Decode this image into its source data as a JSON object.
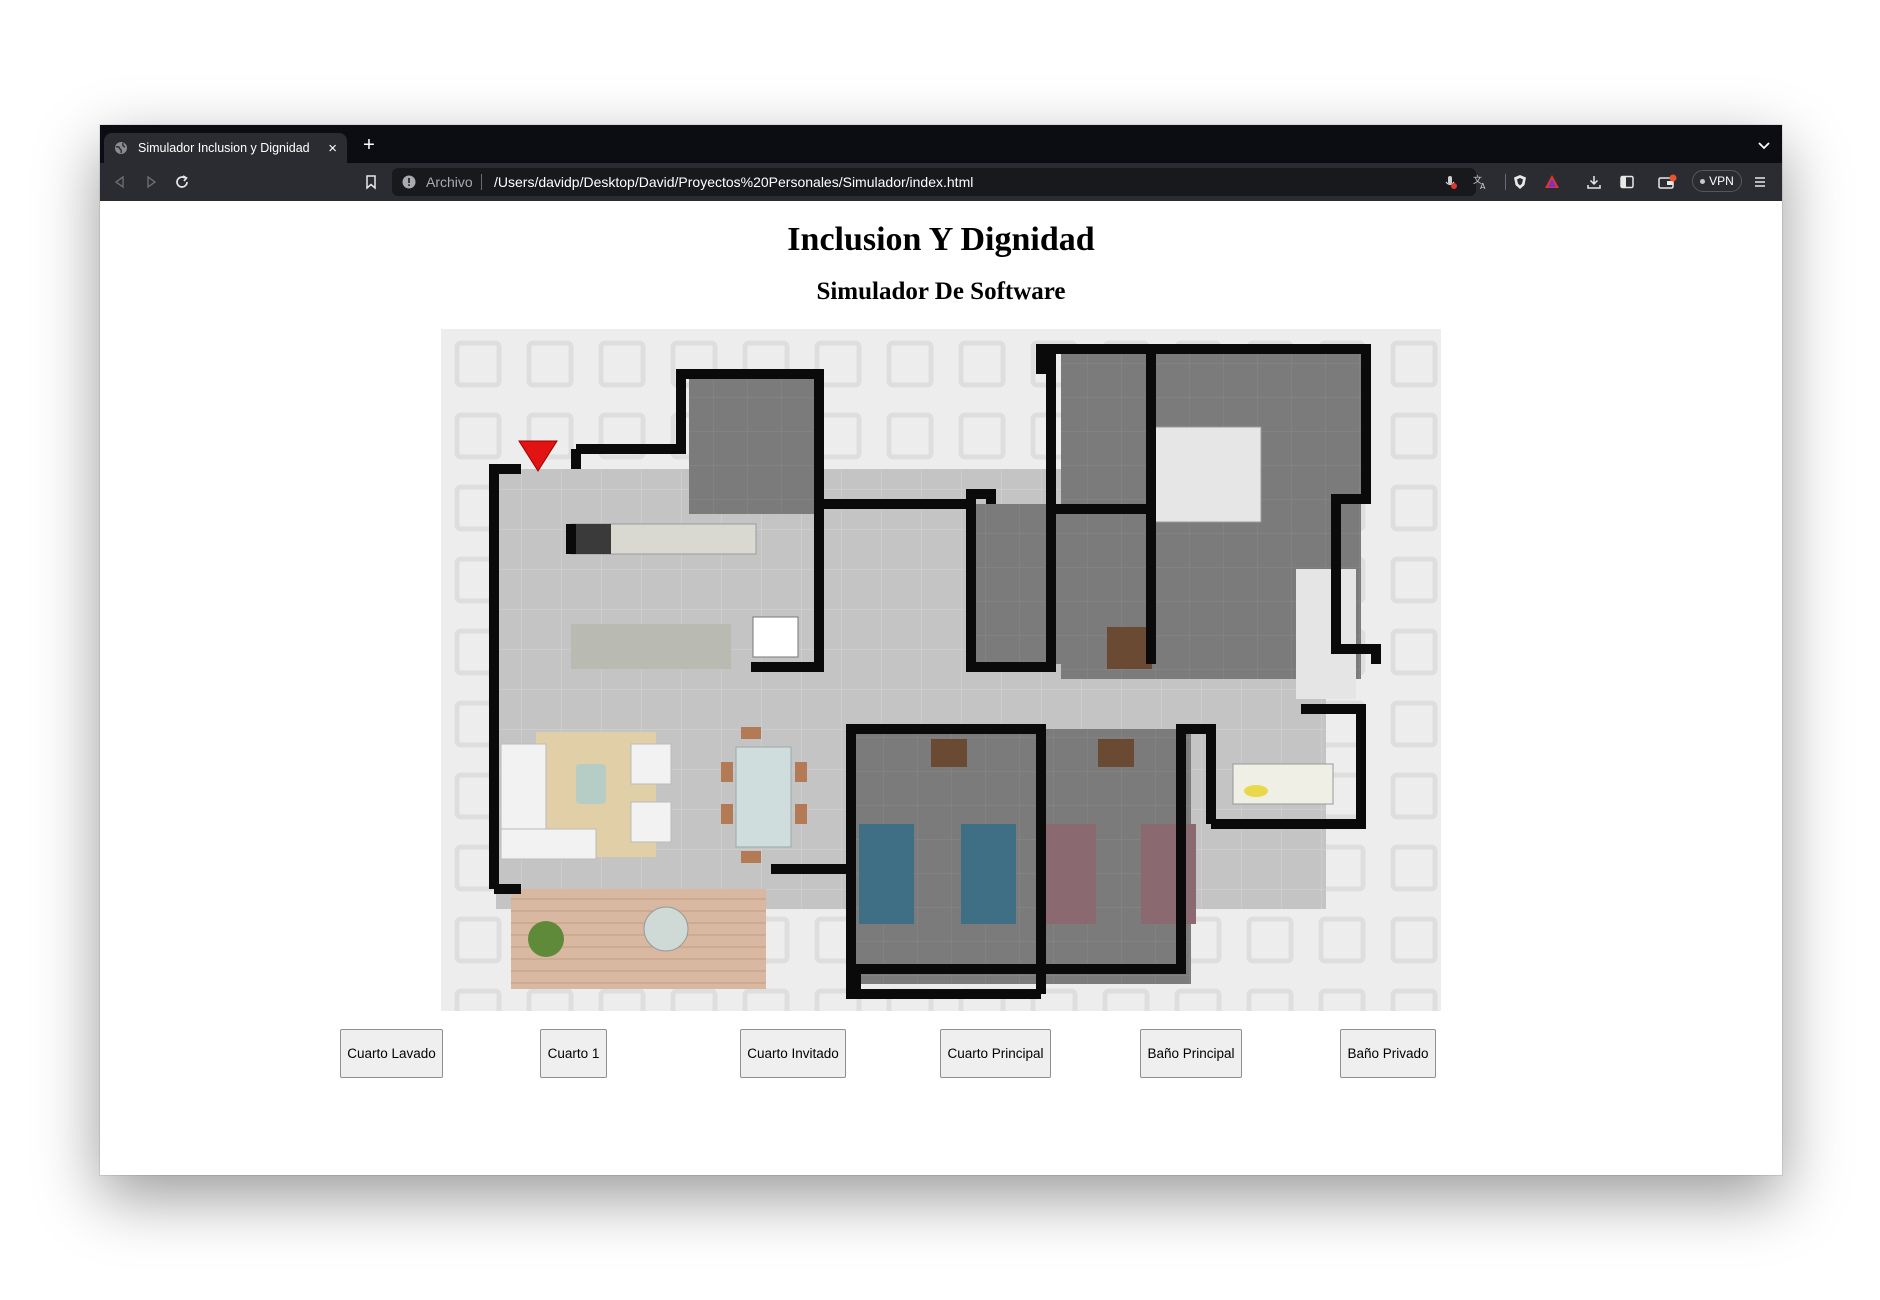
{
  "browser": {
    "tab_title": "Simulador Inclusion y Dignidad",
    "tab_close": "×",
    "new_tab": "+",
    "url_scheme": "Archivo",
    "url": "/Users/davidp/Desktop/David/Proyectos%20Personales/Simulador/index.html",
    "vpn_label": "VPN"
  },
  "page": {
    "title": "Inclusion Y Dignidad",
    "subtitle": "Simulador De Software"
  },
  "buttons": [
    {
      "label": "Cuarto Lavado"
    },
    {
      "label": "Cuarto 1"
    },
    {
      "label": "Cuarto Invitado"
    },
    {
      "label": "Cuarto Principal"
    },
    {
      "label": "Baño Principal"
    },
    {
      "label": "Baño Privado"
    }
  ],
  "icons": {
    "tab_favicon": "globe-icon",
    "back": "back-arrow-icon",
    "forward": "forward-arrow-icon",
    "reload": "reload-icon",
    "bookmark": "bookmark-icon",
    "site_info": "info-icon",
    "mic_blocked": "mic-blocked-icon",
    "translate": "translate-icon",
    "shield": "brave-shield-icon",
    "rewards": "brave-rewards-icon",
    "download": "download-icon",
    "sidebar": "sidebar-icon",
    "wallet": "wallet-icon",
    "menu": "hamburger-menu-icon",
    "position_marker": "red-arrow-marker-icon"
  },
  "colors": {
    "tabbar_bg": "#0c0d12",
    "toolbar_bg": "#2a2c32",
    "marker": "#e11313",
    "wall": "#0a0a0a",
    "floor": "#c4c4c4"
  }
}
